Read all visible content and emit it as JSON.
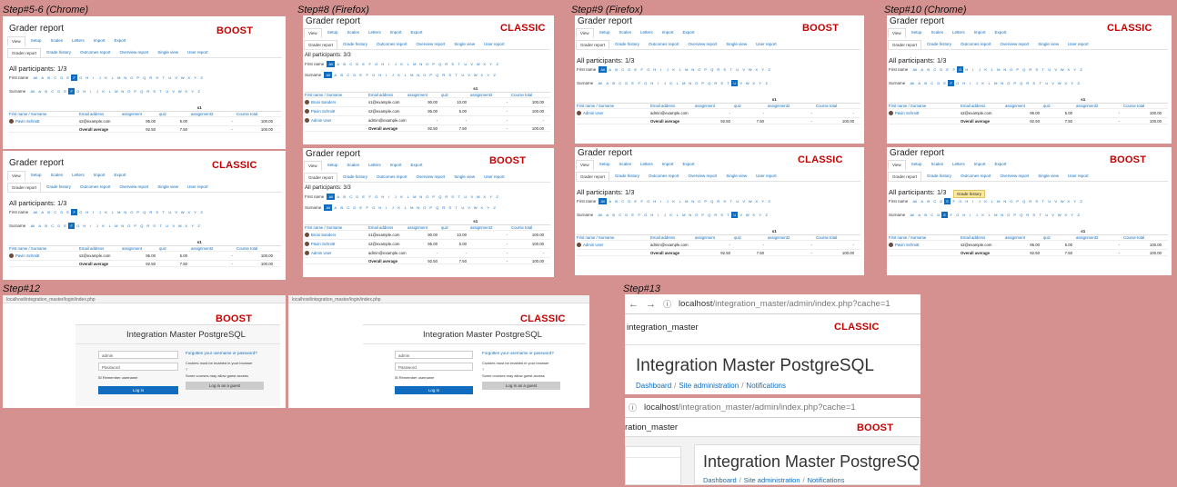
{
  "captions": {
    "s56": "Step#5-6 (Chrome)",
    "s8": "Step#8 (Firefox)",
    "s9": "Step#9 (Firefox)",
    "s10": "Step#10 (Chrome)",
    "s12": "Step#12",
    "s13": "Step#13"
  },
  "themes": {
    "boost": "BOOST",
    "classic": "CLASSIC"
  },
  "grader": {
    "title": "Grader report",
    "nav_tabs": [
      "View",
      "Setup",
      "Scales",
      "Letters",
      "Import",
      "Export"
    ],
    "sub_tabs": [
      "Grader report",
      "Grade history",
      "Outcomes report",
      "Overview report",
      "Single view",
      "User report"
    ],
    "first_name": "First name",
    "surname": "Surname",
    "all": "All",
    "letters": [
      "A",
      "B",
      "C",
      "D",
      "E",
      "F",
      "G",
      "H",
      "I",
      "J",
      "K",
      "L",
      "M",
      "N",
      "O",
      "P",
      "Q",
      "R",
      "S",
      "T",
      "U",
      "V",
      "W",
      "X",
      "Y",
      "Z"
    ],
    "participants_13": "All participants: 1/3",
    "participants_33": "All participants: 3/3",
    "cat": "s1",
    "col_name": "First name / Surname",
    "col_email": "Email address",
    "col_a1": "assignment",
    "col_quiz": "quiz",
    "col_a2": "assignment2",
    "col_total": "Course total",
    "rows": [
      {
        "name": "Pavin Schmitt",
        "email": "s2@example.com",
        "a1": "95.00",
        "quiz": "5.00",
        "a2": "-",
        "total": "100.00"
      }
    ],
    "rows3": [
      {
        "name": "Bruni Sanders",
        "email": "s1@example.com",
        "a1": "90.00",
        "quiz": "10.00",
        "a2": "-",
        "total": "100.00"
      },
      {
        "name": "Pavin Schmitt",
        "email": "s2@example.com",
        "a1": "95.00",
        "quiz": "5.00",
        "a2": "-",
        "total": "100.00"
      },
      {
        "name": "Admin User",
        "email": "admin@example.com",
        "a1": "-",
        "quiz": "-",
        "a2": "-",
        "total": "-"
      }
    ],
    "admin_row": {
      "name": "Admin User",
      "email": "admin@example.com",
      "a1": "-",
      "quiz": "-",
      "a2": "-",
      "total": "-"
    },
    "overall": "Overall average",
    "avg": {
      "a1": "92.50",
      "quiz": "7.50",
      "a2": "-",
      "total": "100.00"
    },
    "tooltip": "Grade history"
  },
  "login": {
    "url": "localhost/integration_master/login/index.php",
    "site": "Integration Master PostgreSQL",
    "username": "admin",
    "password_ph": "Password",
    "remember": "Remember username",
    "login_btn": "Log in",
    "forgot": "Forgotten your username or password?",
    "cookies": "Cookies must be enabled in your browser",
    "guest_note": "Some courses may allow guest access",
    "guest_btn": "Log in as a guest"
  },
  "admin": {
    "host": "localhost",
    "path": "/integration_master/admin/index.php?cache=1",
    "shortname": "integration_master",
    "shortname_cut": "ration_master",
    "title": "Integration Master PostgreSQL",
    "bc": [
      "Dashboard",
      "Site administration",
      "Notifications"
    ]
  }
}
